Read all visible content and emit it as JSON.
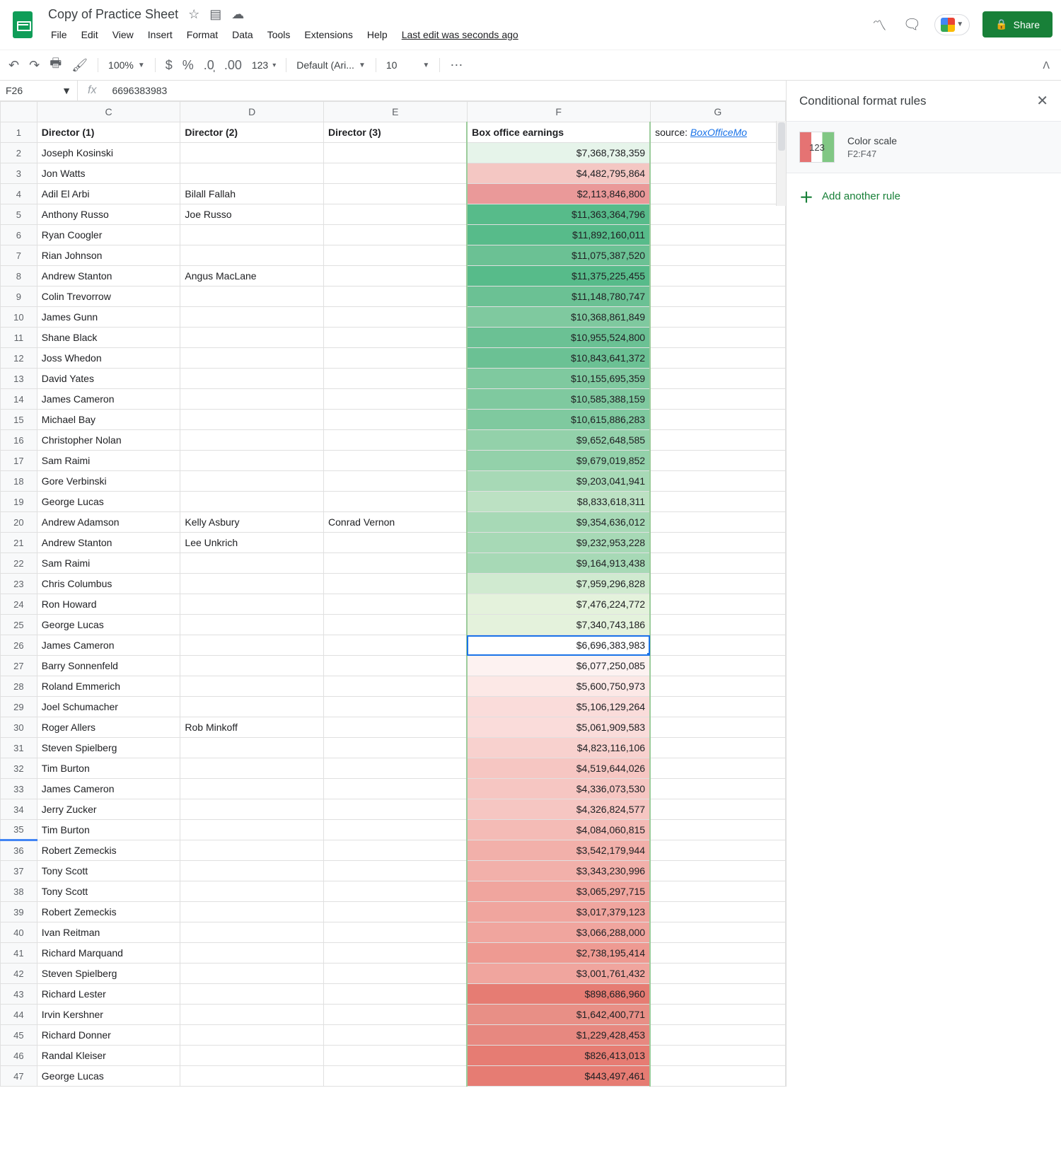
{
  "doc": {
    "title": "Copy of Practice Sheet",
    "last_edit": "Last edit was seconds ago"
  },
  "menu": {
    "file": "File",
    "edit": "Edit",
    "view": "View",
    "insert": "Insert",
    "format": "Format",
    "data": "Data",
    "tools": "Tools",
    "extensions": "Extensions",
    "help": "Help"
  },
  "share": {
    "label": "Share"
  },
  "toolbar": {
    "zoom": "100%",
    "fmt": "123",
    "font": "Default (Ari...",
    "size": "10"
  },
  "namebox": "F26",
  "formula_value": "6696383983",
  "columns": {
    "C": "C",
    "D": "D",
    "E": "E",
    "F": "F",
    "G": "G"
  },
  "headers": {
    "c": "Director (1)",
    "d": "Director (2)",
    "e": "Director (3)",
    "f": "Box office earnings",
    "g_prefix": "source: ",
    "g_link": "BoxOfficeMo"
  },
  "sidepanel": {
    "title": "Conditional format rules",
    "rule_preview_text": "123",
    "rule_title": "Color scale",
    "rule_range": "F2:F47",
    "add_rule": "Add another rule"
  },
  "rows": [
    {
      "n": 2,
      "c": "Joseph Kosinski",
      "d": "",
      "e": "",
      "f": "$7,368,738,359",
      "bg": "#e6f4ea"
    },
    {
      "n": 3,
      "c": "Jon Watts",
      "d": "",
      "e": "",
      "f": "$4,482,795,864",
      "bg": "#f4c7c3"
    },
    {
      "n": 4,
      "c": "Adil El Arbi",
      "d": "Bilall Fallah",
      "e": "",
      "f": "$2,113,846,800",
      "bg": "#ea9999"
    },
    {
      "n": 5,
      "c": "Anthony Russo",
      "d": "Joe Russo",
      "e": "",
      "f": "$11,363,364,796",
      "bg": "#57bb8a"
    },
    {
      "n": 6,
      "c": "Ryan Coogler",
      "d": "",
      "e": "",
      "f": "$11,892,160,011",
      "bg": "#57bb8a"
    },
    {
      "n": 7,
      "c": "Rian Johnson",
      "d": "",
      "e": "",
      "f": "$11,075,387,520",
      "bg": "#6bc194"
    },
    {
      "n": 8,
      "c": "Andrew Stanton",
      "d": "Angus MacLane",
      "e": "",
      "f": "$11,375,225,455",
      "bg": "#57bb8a"
    },
    {
      "n": 9,
      "c": "Colin Trevorrow",
      "d": "",
      "e": "",
      "f": "$11,148,780,747",
      "bg": "#6bc194"
    },
    {
      "n": 10,
      "c": "James Gunn",
      "d": "",
      "e": "",
      "f": "$10,368,861,849",
      "bg": "#7fc99f"
    },
    {
      "n": 11,
      "c": "Shane Black",
      "d": "",
      "e": "",
      "f": "$10,955,524,800",
      "bg": "#6bc194"
    },
    {
      "n": 12,
      "c": "Joss Whedon",
      "d": "",
      "e": "",
      "f": "$10,843,641,372",
      "bg": "#6bc194"
    },
    {
      "n": 13,
      "c": "David Yates",
      "d": "",
      "e": "",
      "f": "$10,155,695,359",
      "bg": "#7fc99f"
    },
    {
      "n": 14,
      "c": "James Cameron",
      "d": "",
      "e": "",
      "f": "$10,585,388,159",
      "bg": "#7fc99f"
    },
    {
      "n": 15,
      "c": "Michael Bay",
      "d": "",
      "e": "",
      "f": "$10,615,886,283",
      "bg": "#7fc99f"
    },
    {
      "n": 16,
      "c": "Christopher Nolan",
      "d": "",
      "e": "",
      "f": "$9,652,648,585",
      "bg": "#93d1aa"
    },
    {
      "n": 17,
      "c": "Sam Raimi",
      "d": "",
      "e": "",
      "f": "$9,679,019,852",
      "bg": "#93d1aa"
    },
    {
      "n": 18,
      "c": "Gore Verbinski",
      "d": "",
      "e": "",
      "f": "$9,203,041,941",
      "bg": "#a7d9b6"
    },
    {
      "n": 19,
      "c": "George Lucas",
      "d": "",
      "e": "",
      "f": "$8,833,618,311",
      "bg": "#bce1c3"
    },
    {
      "n": 20,
      "c": "Andrew Adamson",
      "d": "Kelly Asbury",
      "e": "Conrad Vernon",
      "f": "$9,354,636,012",
      "bg": "#a7d9b6"
    },
    {
      "n": 21,
      "c": "Andrew Stanton",
      "d": "Lee Unkrich",
      "e": "",
      "f": "$9,232,953,228",
      "bg": "#a7d9b6"
    },
    {
      "n": 22,
      "c": "Sam Raimi",
      "d": "",
      "e": "",
      "f": "$9,164,913,438",
      "bg": "#a7d9b6"
    },
    {
      "n": 23,
      "c": "Chris Columbus",
      "d": "",
      "e": "",
      "f": "$7,959,296,828",
      "bg": "#d0ead0"
    },
    {
      "n": 24,
      "c": "Ron Howard",
      "d": "",
      "e": "",
      "f": "$7,476,224,772",
      "bg": "#e4f2dc"
    },
    {
      "n": 25,
      "c": "George Lucas",
      "d": "",
      "e": "",
      "f": "$7,340,743,186",
      "bg": "#e4f2dc"
    },
    {
      "n": 26,
      "c": "James Cameron",
      "d": "",
      "e": "",
      "f": "$6,696,383,983",
      "bg": "#ffffff",
      "sel": true
    },
    {
      "n": 27,
      "c": "Barry Sonnenfeld",
      "d": "",
      "e": "",
      "f": "$6,077,250,085",
      "bg": "#fdf2f1"
    },
    {
      "n": 28,
      "c": "Roland Emmerich",
      "d": "",
      "e": "",
      "f": "$5,600,750,973",
      "bg": "#fce8e6"
    },
    {
      "n": 29,
      "c": "Joel Schumacher",
      "d": "",
      "e": "",
      "f": "$5,106,129,264",
      "bg": "#fadcda"
    },
    {
      "n": 30,
      "c": "Roger Allers",
      "d": "Rob Minkoff",
      "e": "",
      "f": "$5,061,909,583",
      "bg": "#fadcda"
    },
    {
      "n": 31,
      "c": "Steven Spielberg",
      "d": "",
      "e": "",
      "f": "$4,823,116,106",
      "bg": "#f8d1ce"
    },
    {
      "n": 32,
      "c": "Tim Burton",
      "d": "",
      "e": "",
      "f": "$4,519,644,026",
      "bg": "#f6c6c2"
    },
    {
      "n": 33,
      "c": "James Cameron",
      "d": "",
      "e": "",
      "f": "$4,336,073,530",
      "bg": "#f6c6c2"
    },
    {
      "n": 34,
      "c": "Jerry Zucker",
      "d": "",
      "e": "",
      "f": "$4,326,824,577",
      "bg": "#f6c6c2"
    },
    {
      "n": 35,
      "c": "Tim Burton",
      "d": "",
      "e": "",
      "f": "$4,084,060,815",
      "bg": "#f4bbb6"
    },
    {
      "n": 36,
      "c": "Robert Zemeckis",
      "d": "",
      "e": "",
      "f": "$3,542,179,944",
      "bg": "#f2b0aa"
    },
    {
      "n": 37,
      "c": "Tony Scott",
      "d": "",
      "e": "",
      "f": "$3,343,230,996",
      "bg": "#f2b0aa"
    },
    {
      "n": 38,
      "c": "Tony Scott",
      "d": "",
      "e": "",
      "f": "$3,065,297,715",
      "bg": "#f0a59e"
    },
    {
      "n": 39,
      "c": "Robert Zemeckis",
      "d": "",
      "e": "",
      "f": "$3,017,379,123",
      "bg": "#f0a59e"
    },
    {
      "n": 40,
      "c": "Ivan Reitman",
      "d": "",
      "e": "",
      "f": "$3,066,288,000",
      "bg": "#f0a59e"
    },
    {
      "n": 41,
      "c": "Richard Marquand",
      "d": "",
      "e": "",
      "f": "$2,738,195,414",
      "bg": "#ee9a92"
    },
    {
      "n": 42,
      "c": "Steven Spielberg",
      "d": "",
      "e": "",
      "f": "$3,001,761,432",
      "bg": "#f0a59e"
    },
    {
      "n": 43,
      "c": "Richard Lester",
      "d": "",
      "e": "",
      "f": "$898,686,960",
      "bg": "#e67c73"
    },
    {
      "n": 44,
      "c": "Irvin Kershner",
      "d": "",
      "e": "",
      "f": "$1,642,400,771",
      "bg": "#e88f86"
    },
    {
      "n": 45,
      "c": "Richard Donner",
      "d": "",
      "e": "",
      "f": "$1,229,428,453",
      "bg": "#e78880"
    },
    {
      "n": 46,
      "c": "Randal Kleiser",
      "d": "",
      "e": "",
      "f": "$826,413,013",
      "bg": "#e67c73"
    },
    {
      "n": 47,
      "c": "George Lucas",
      "d": "",
      "e": "",
      "f": "$443,497,461",
      "bg": "#e67c73"
    }
  ]
}
